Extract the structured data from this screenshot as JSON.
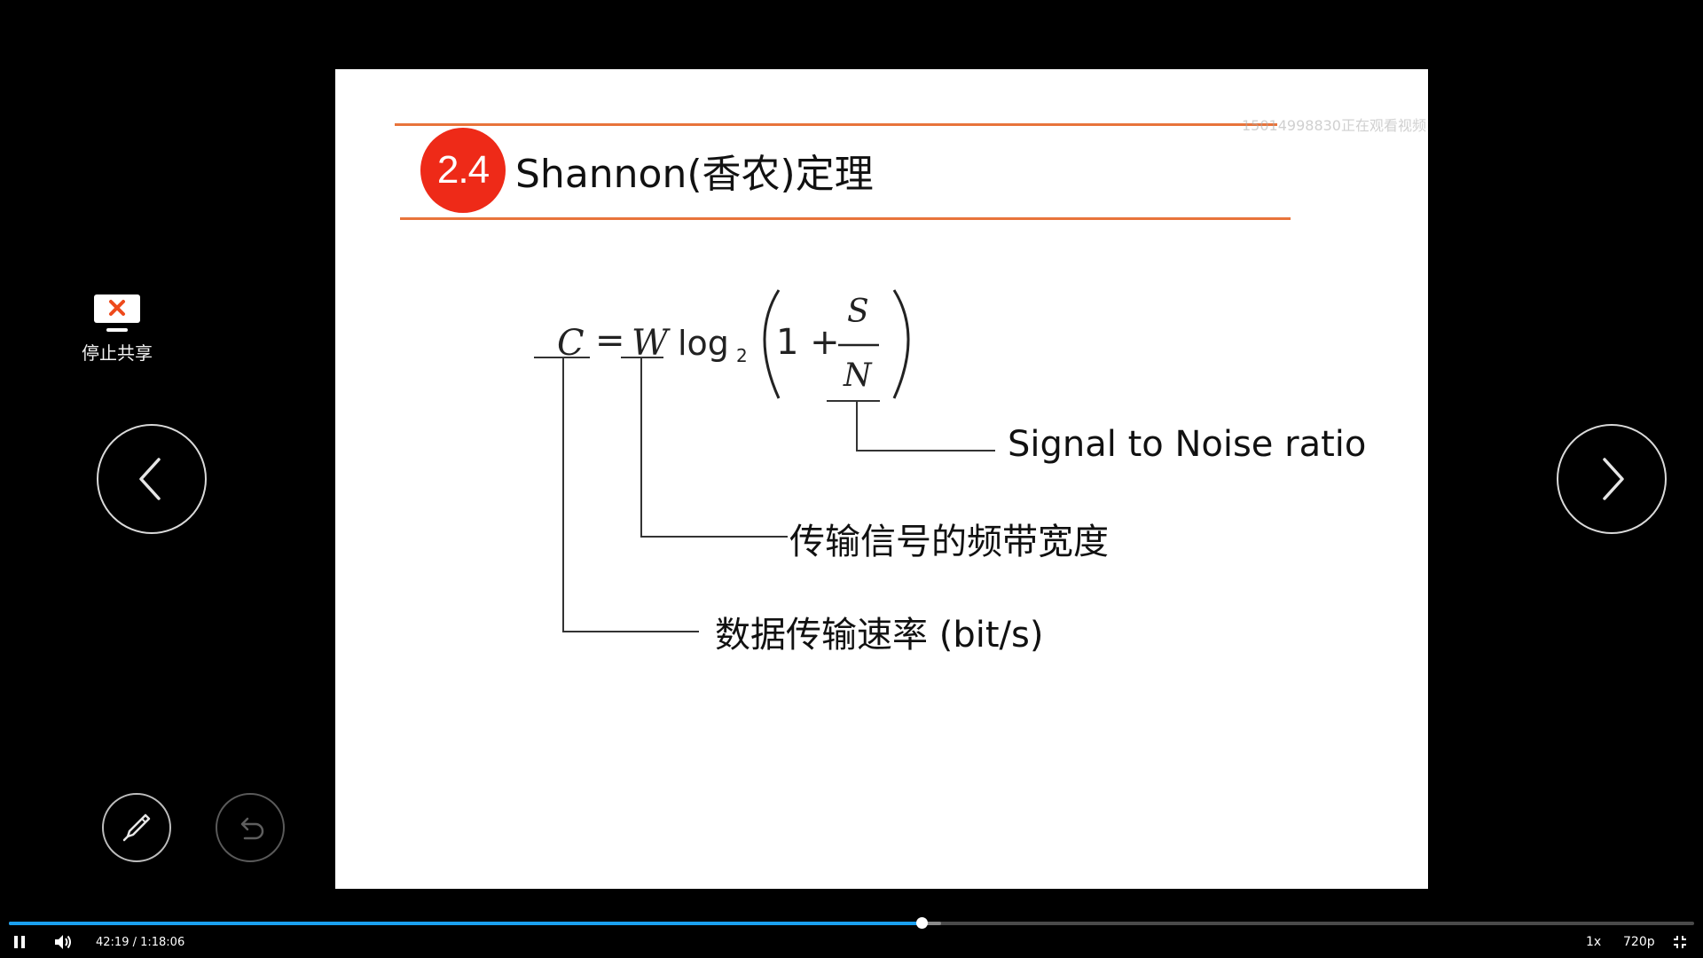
{
  "slide": {
    "section_number": "2.4",
    "title": "Shannon(香农)定理",
    "watermark": "15014998830正在观看视频",
    "formula": {
      "C": "C",
      "equals": "=",
      "W": "W",
      "log": "log",
      "base": "2",
      "one_plus": "1 +",
      "S": "S",
      "N": "N"
    },
    "labels": {
      "snr": "Signal to Noise ratio",
      "bandwidth": "传输信号的频带宽度",
      "data_rate": "数据传输速率 (bit/s)"
    }
  },
  "controls": {
    "stop_share_label": "停止共享",
    "stop_share_icon": "monitor-close-icon",
    "prev_icon": "chevron-left-icon",
    "next_icon": "chevron-right-icon",
    "pen_icon": "pen-icon",
    "undo_icon": "undo-icon"
  },
  "player": {
    "time": "42:19 / 1:18:06",
    "progress_fraction": 0.5418,
    "buffered_fraction": 0.553,
    "speed": "1x",
    "quality": "720p",
    "accent_color": "#1aa0f0"
  }
}
